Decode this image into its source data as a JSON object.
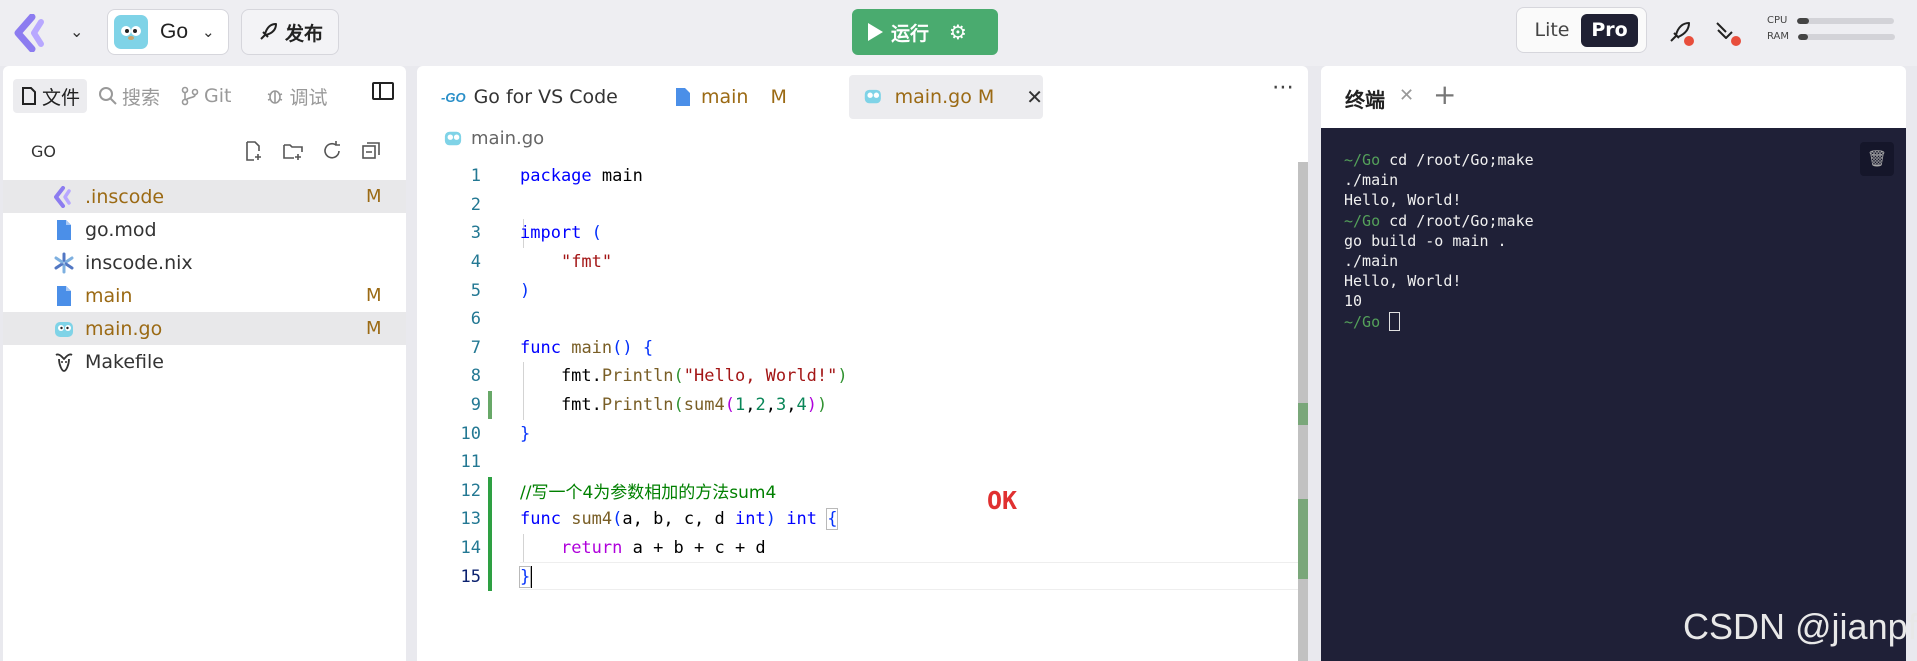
{
  "topbar": {
    "project_name": "Go",
    "publish_label": "发布",
    "run_label": "运行",
    "mode_lite": "Lite",
    "mode_pro": "Pro",
    "cpu_label": "CPU",
    "ram_label": "RAM",
    "cpu_usage": 0.12,
    "ram_usage": 0.1
  },
  "sidebar": {
    "tabs": [
      {
        "label": "文件",
        "icon": "file-icon"
      },
      {
        "label": "搜索",
        "icon": "search-icon"
      },
      {
        "label": "Git",
        "icon": "git-icon"
      },
      {
        "label": "调试",
        "icon": "bug-icon"
      }
    ],
    "project_header": "GO",
    "files": [
      {
        "name": ".inscode",
        "badge": "M",
        "icon": "inscode-icon",
        "modified": true,
        "selected": true
      },
      {
        "name": "go.mod",
        "badge": "",
        "icon": "file-icon",
        "modified": false,
        "selected": false
      },
      {
        "name": "inscode.nix",
        "badge": "",
        "icon": "nix-icon",
        "modified": false,
        "selected": false
      },
      {
        "name": "main",
        "badge": "M",
        "icon": "file-icon",
        "modified": true,
        "selected": false
      },
      {
        "name": "main.go",
        "badge": "M",
        "icon": "gopher-icon",
        "modified": true,
        "selected": true
      },
      {
        "name": "Makefile",
        "badge": "",
        "icon": "gnu-icon",
        "modified": false,
        "selected": false
      }
    ]
  },
  "editor": {
    "tabs": [
      {
        "label": "Go for VS Code",
        "badge": ""
      },
      {
        "label": "main",
        "badge": "M"
      },
      {
        "label": "main.go",
        "badge": "M"
      }
    ],
    "breadcrumb": "main.go",
    "line_numbers": [
      "1",
      "2",
      "3",
      "4",
      "5",
      "6",
      "7",
      "8",
      "9",
      "10",
      "11",
      "12",
      "13",
      "14",
      "15"
    ],
    "annotation": "OK"
  },
  "terminal": {
    "tab_label": "终端",
    "lines": [
      {
        "prompt": "~/Go",
        "text": " cd /root/Go;make"
      },
      {
        "prompt": "",
        "text": "./main"
      },
      {
        "prompt": "",
        "text": "Hello, World!"
      },
      {
        "prompt": "~/Go",
        "text": " cd /root/Go;make"
      },
      {
        "prompt": "",
        "text": "go build -o main ."
      },
      {
        "prompt": "",
        "text": "./main"
      },
      {
        "prompt": "",
        "text": "Hello, World!"
      },
      {
        "prompt": "",
        "text": "10"
      }
    ],
    "final_prompt": "~/Go"
  },
  "watermark": "CSDN @jianpf",
  "colors": {
    "run_green": "#4aab6f",
    "terminal_bg": "#1f2037",
    "modified_brown": "#9b6a14",
    "ok_red": "#e03030"
  }
}
